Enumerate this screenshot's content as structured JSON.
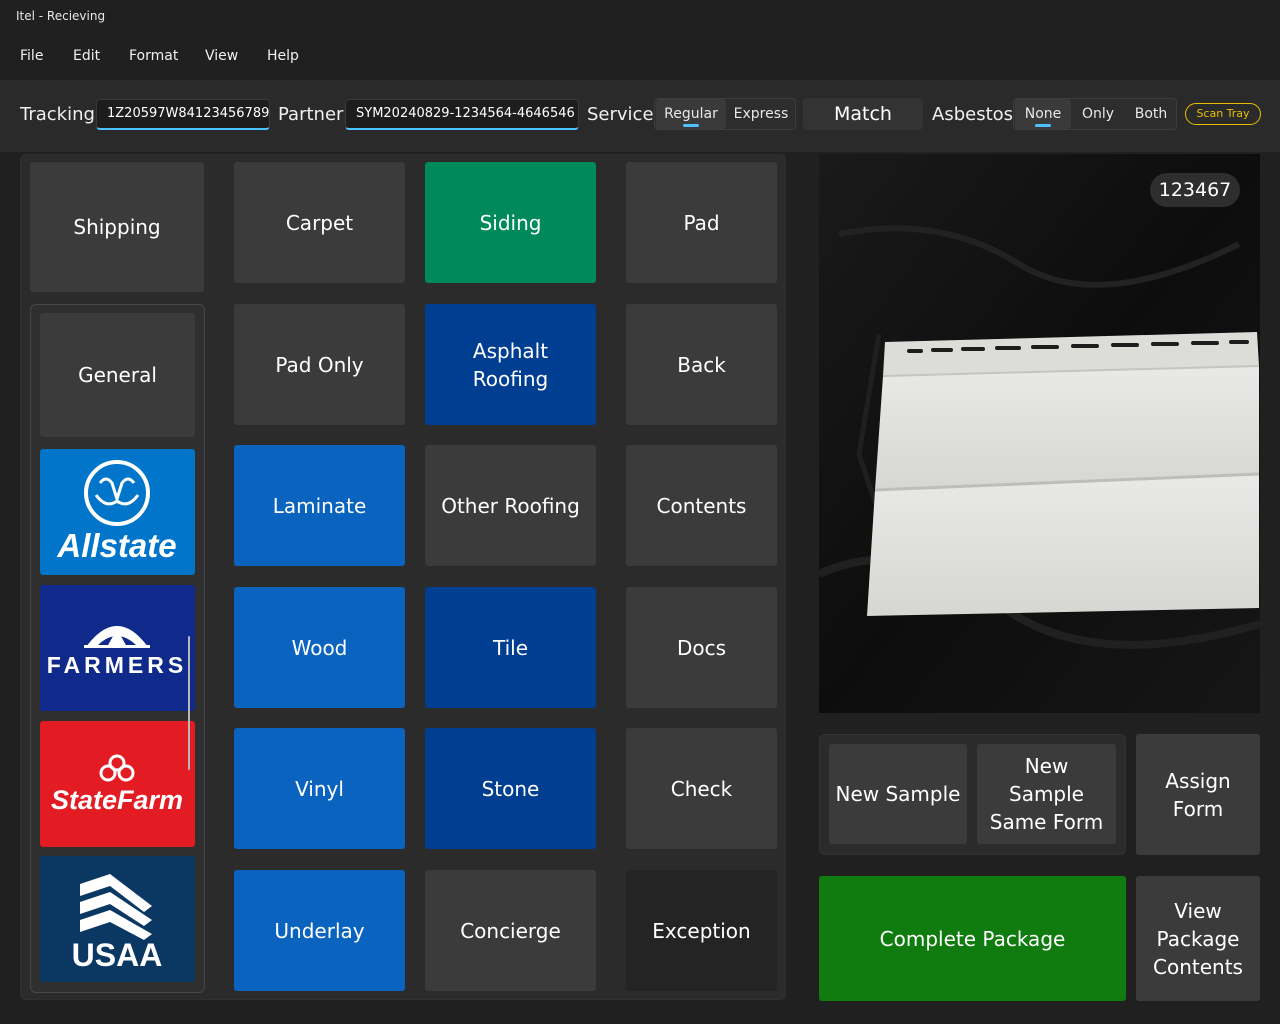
{
  "window": {
    "title": "Itel - Recieving"
  },
  "menu": [
    "File",
    "Edit",
    "Format",
    "View",
    "Help"
  ],
  "toolbar": {
    "tracking_label": "Tracking",
    "tracking_value": "1Z20597W84123456789",
    "partner_label": "Partner",
    "partner_value": "SYM20240829-1234564-4646546",
    "service_label": "Service",
    "service_options": [
      "Regular",
      "Express"
    ],
    "service_selected": "Regular",
    "match_label": "Match",
    "asbestos_label": "Asbestos",
    "asbestos_options": [
      "None",
      "Only",
      "Both"
    ],
    "asbestos_selected": "None",
    "scan_tray_label": "Scan Tray"
  },
  "left": {
    "shipping": "Shipping",
    "general": "General",
    "partners": [
      {
        "name": "Allstate",
        "color": "#0075c9"
      },
      {
        "name": "FARMERS",
        "color": "#0f2a8a"
      },
      {
        "name": "StateFarm",
        "color": "#e31b23"
      },
      {
        "name": "USAA",
        "color": "#0b3763"
      }
    ]
  },
  "categories": {
    "col1": [
      "Carpet",
      "Pad Only",
      "Laminate",
      "Wood",
      "Vinyl",
      "Underlay"
    ],
    "col2": [
      "Siding",
      "Asphalt Roofing",
      "Other Roofing",
      "Tile",
      "Stone",
      "Concierge"
    ],
    "col3": [
      "Pad",
      "Back",
      "Contents",
      "Docs",
      "Check",
      "Exception"
    ],
    "selected": "Siding"
  },
  "photo": {
    "badge": "123467"
  },
  "actions": {
    "new_sample": "New Sample",
    "new_sample_same_form": "New Sample Same Form",
    "assign_form": "Assign Form",
    "complete_package": "Complete Package",
    "view_package_contents": "View Package Contents"
  },
  "colors": {
    "accent": "#4cc2ff",
    "selected_tile": "#00895a",
    "complete": "#107c10",
    "warning": "#e8c000"
  }
}
